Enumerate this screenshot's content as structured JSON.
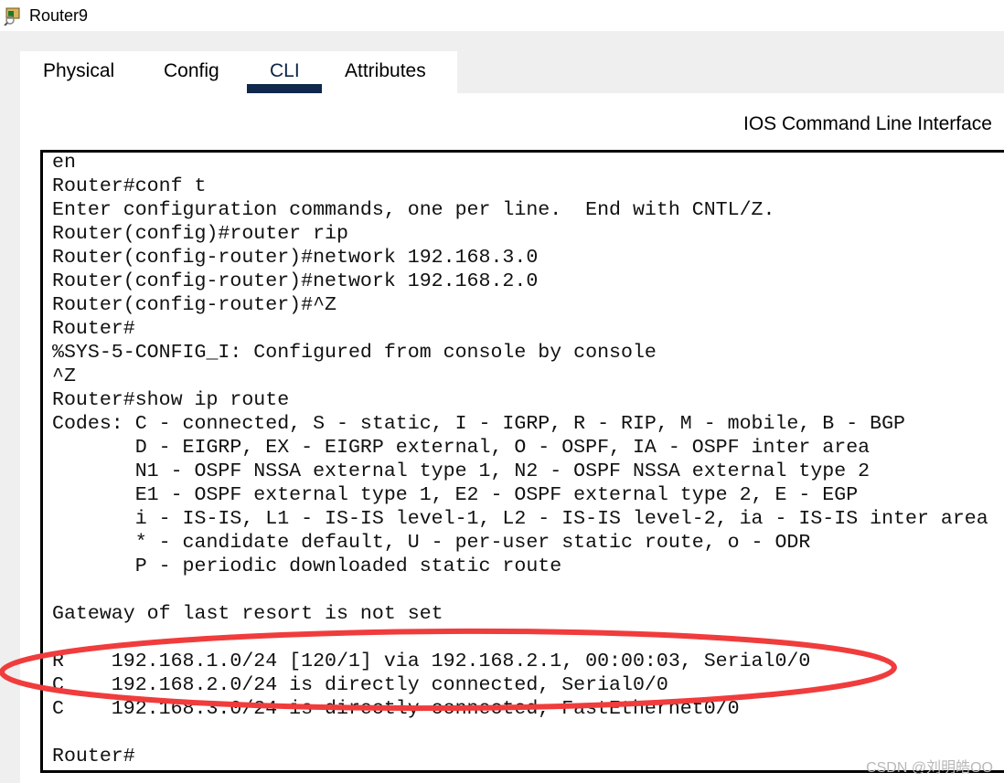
{
  "window": {
    "title": "Router9",
    "icon": "router-icon"
  },
  "tabs": [
    {
      "label": "Physical"
    },
    {
      "label": "Config"
    },
    {
      "label": "CLI",
      "active": true
    },
    {
      "label": "Attributes"
    }
  ],
  "header": "IOS Command Line Interface",
  "terminal": {
    "lines": [
      "en",
      "Router#conf t",
      "Enter configuration commands, one per line.  End with CNTL/Z.",
      "Router(config)#router rip",
      "Router(config-router)#network 192.168.3.0",
      "Router(config-router)#network 192.168.2.0",
      "Router(config-router)#^Z",
      "Router#",
      "%SYS-5-CONFIG_I: Configured from console by console",
      "^Z",
      "Router#show ip route",
      "Codes: C - connected, S - static, I - IGRP, R - RIP, M - mobile, B - BGP",
      "       D - EIGRP, EX - EIGRP external, O - OSPF, IA - OSPF inter area",
      "       N1 - OSPF NSSA external type 1, N2 - OSPF NSSA external type 2",
      "       E1 - OSPF external type 1, E2 - OSPF external type 2, E - EGP",
      "       i - IS-IS, L1 - IS-IS level-1, L2 - IS-IS level-2, ia - IS-IS inter area",
      "       * - candidate default, U - per-user static route, o - ODR",
      "       P - periodic downloaded static route",
      "",
      "Gateway of last resort is not set",
      "",
      "R    192.168.1.0/24 [120/1] via 192.168.2.1, 00:00:03, Serial0/0",
      "C    192.168.2.0/24 is directly connected, Serial0/0",
      "C    192.168.3.0/24 is directly connected, FastEthernet0/0",
      "",
      "Router#"
    ]
  },
  "annotation_color": "#f03c3c",
  "watermark": "CSDN @刘明皓OO"
}
